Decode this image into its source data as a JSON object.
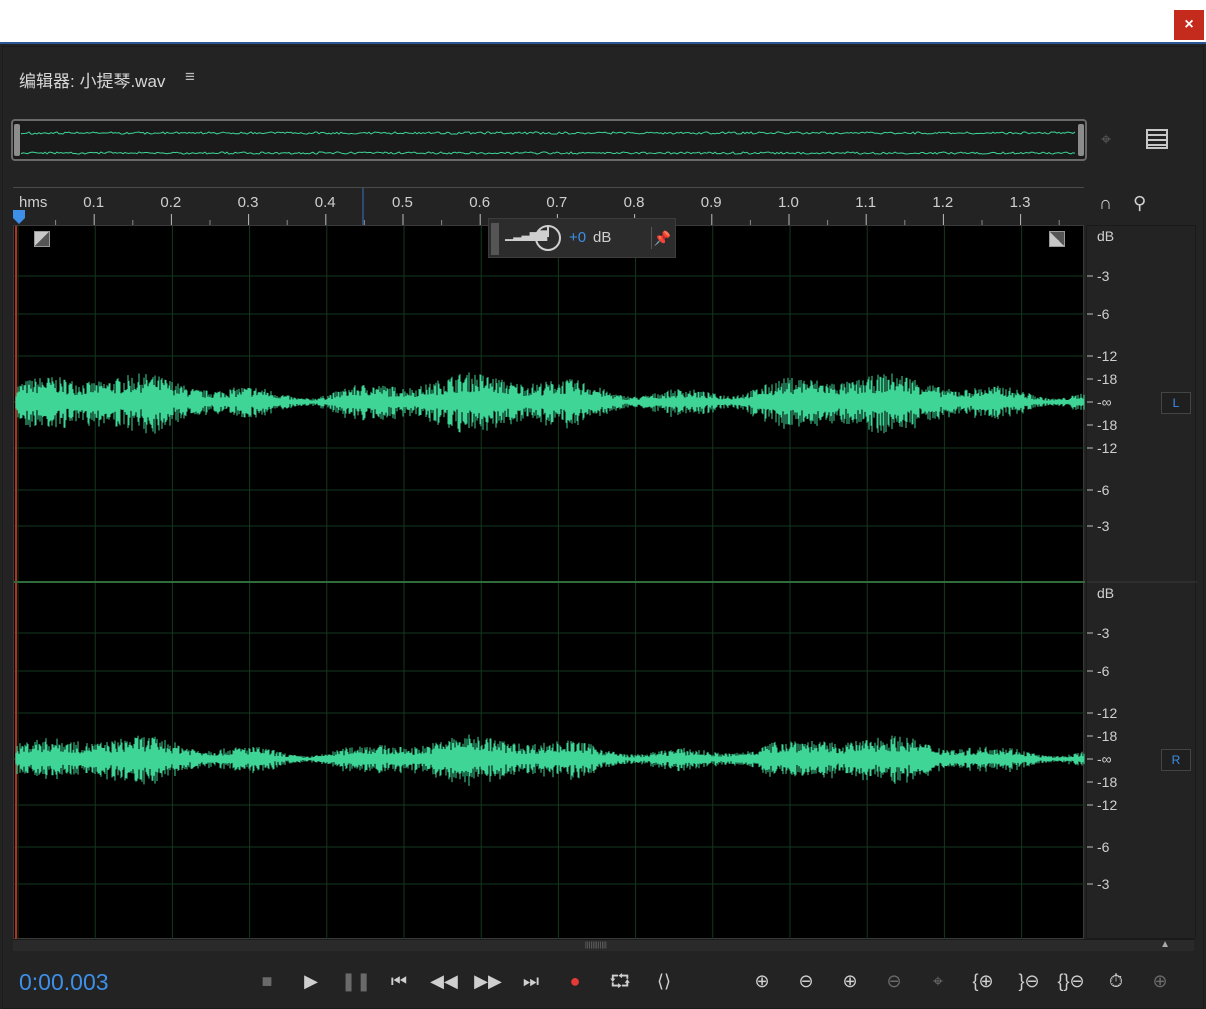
{
  "window": {
    "close_label": "×"
  },
  "editor": {
    "title": "编辑器: 小提琴.wav",
    "menu_icon": "≡"
  },
  "ruler": {
    "unit_label": "hms",
    "ticks": [
      "0.1",
      "0.2",
      "0.3",
      "0.4",
      "0.5",
      "0.6",
      "0.7",
      "0.8",
      "0.9",
      "1.0",
      "1.1",
      "1.2",
      "1.3"
    ]
  },
  "hud": {
    "volume_value": "+0",
    "volume_unit": "dB"
  },
  "db_scale": {
    "top_channel": [
      "dB",
      "-3",
      "-6",
      "-12",
      "-18",
      "-∞",
      "-18",
      "-12",
      "-6",
      "-3"
    ],
    "bottom_channel": [
      "dB",
      "-3",
      "-6",
      "-12",
      "-18",
      "-∞",
      "-18",
      "-12",
      "-6",
      "-3"
    ],
    "left_label": "L",
    "right_label": "R"
  },
  "timecode": "0:00.003",
  "colors": {
    "waveform": "#3fd597",
    "accent": "#3d8fe8",
    "record": "#e53935"
  },
  "icons": {
    "transport": [
      "stop-icon",
      "play-icon",
      "pause-icon",
      "go-to-start-icon",
      "rewind-icon",
      "fast-forward-icon",
      "go-to-end-icon",
      "record-icon",
      "loop-icon",
      "skip-selection-icon"
    ],
    "zoom": [
      "zoom-in-amplitude-icon",
      "zoom-out-amplitude-icon",
      "zoom-in-time-icon",
      "zoom-out-time-icon",
      "zoom-selection-icon",
      "zoom-in-point-icon",
      "zoom-out-point-icon",
      "zoom-full-icon",
      "zoom-reset-icon",
      "zoom-out-full-icon"
    ]
  }
}
